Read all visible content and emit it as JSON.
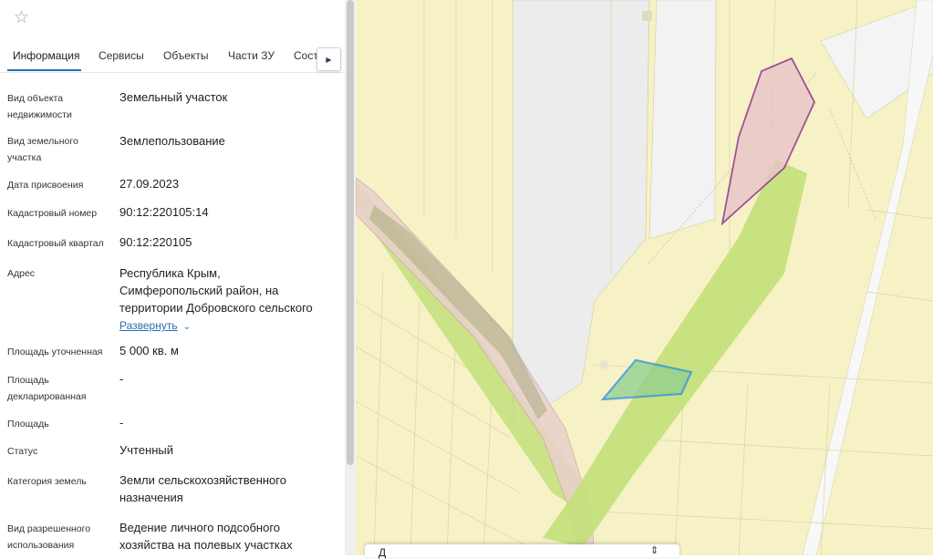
{
  "favorite_icon": "star-outline-icon",
  "tabs": [
    {
      "label": "Информация",
      "active": true
    },
    {
      "label": "Сервисы"
    },
    {
      "label": "Объекты"
    },
    {
      "label": "Части ЗУ"
    },
    {
      "label": "Соста"
    }
  ],
  "tabs_next_icon": "triangle-right-icon",
  "info": {
    "object_type": {
      "label1": "Вид объекта",
      "label2": "недвижимости",
      "value": "Земельный участок"
    },
    "land_type": {
      "label1": "Вид земельного",
      "label2": "участка",
      "value": "Землепользование"
    },
    "assigned_date": {
      "label": "Дата присвоения",
      "value": "27.09.2023"
    },
    "cadastral_number": {
      "label": "Кадастровый номер",
      "value": "90:12:220105:14"
    },
    "cadastral_quarter": {
      "label": "Кадастровый квартал",
      "value": "90:12:220105"
    },
    "address": {
      "label": "Адрес",
      "line1": "Республика Крым,",
      "line2": "Симферопольский район, на",
      "line3": "территории Добровского сельского",
      "expand": "Развернуть"
    },
    "area_specified": {
      "label": "Площадь уточненная",
      "value": "5 000 кв. м"
    },
    "area_declared": {
      "label1": "Площадь",
      "label2": "декларированная",
      "value": "-"
    },
    "area": {
      "label": "Площадь",
      "value": "-"
    },
    "status": {
      "label": "Статус",
      "value": "Учтенный"
    },
    "land_category": {
      "label": "Категория земель",
      "line1": "Земли сельскохозяйственного",
      "line2": "назначения"
    },
    "permitted_use": {
      "label1": "Вид разрешенного",
      "label2": "использования",
      "line1": "Ведение личного подсобного",
      "line2": "хозяйства на полевых участках"
    }
  },
  "bottom_popup": {
    "text": "Д",
    "icon": "arrows-icon"
  },
  "colors": {
    "accent": "#1f6fb2",
    "link": "#2a6db0",
    "map_base": "#f6f2c6",
    "map_green": "#c3e07a",
    "map_pink": "#e8c4c9",
    "parcel_outline": "#2a8de0",
    "purple_outline": "#8a2a8a"
  }
}
